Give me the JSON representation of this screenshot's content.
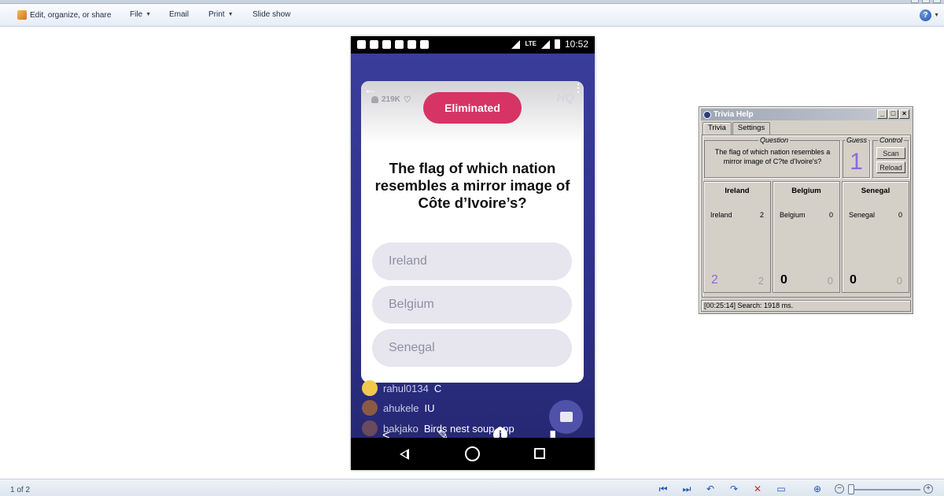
{
  "toolbar": {
    "edit_label": "Edit, organize, or share",
    "file_label": "File",
    "email_label": "Email",
    "print_label": "Print",
    "slideshow_label": "Slide show",
    "help_icon": "?"
  },
  "phone": {
    "clock": "10:52",
    "network": "LTE",
    "viewers": "219K",
    "brand": "HQ",
    "eliminated_label": "Eliminated",
    "question": "The flag of which nation resembles a mirror image of Côte d’Ivoire’s?",
    "answers": [
      "Ireland",
      "Belgium",
      "Senegal"
    ],
    "chat": [
      {
        "user": "rahul0134",
        "message": "C",
        "avatar_color": "#f2c94c"
      },
      {
        "user": "ahukele",
        "message": "IU",
        "avatar_color": "#8a5a44"
      },
      {
        "user": "bakjako",
        "message": "Birds nest soup opp",
        "avatar_color": "#6b4a5e"
      }
    ]
  },
  "trivia_window": {
    "title": "Trivia Help",
    "tabs": [
      "Trivia",
      "Settings"
    ],
    "question_group_label": "Question",
    "guess_group_label": "Guess",
    "control_group_label": "Control",
    "question_text": "The flag of which nation resembles a mirror image of C?te d'Ivoire's?",
    "guess": "1",
    "scan_label": "Scan",
    "reload_label": "Reload",
    "columns": [
      {
        "header": "Ireland",
        "line_label": "Ireland",
        "line_count": "2",
        "big": "2",
        "small": "2",
        "big_color": "#8a6bd9"
      },
      {
        "header": "Belgium",
        "line_label": "Belgium",
        "line_count": "0",
        "big": "0",
        "small": "0",
        "big_color": "#000000"
      },
      {
        "header": "Senegal",
        "line_label": "Senegal",
        "line_count": "0",
        "big": "0",
        "small": "0",
        "big_color": "#000000"
      }
    ],
    "status": "[00:25:14] Search: 1918 ms."
  },
  "bottombar": {
    "page_count": "1 of 2"
  }
}
